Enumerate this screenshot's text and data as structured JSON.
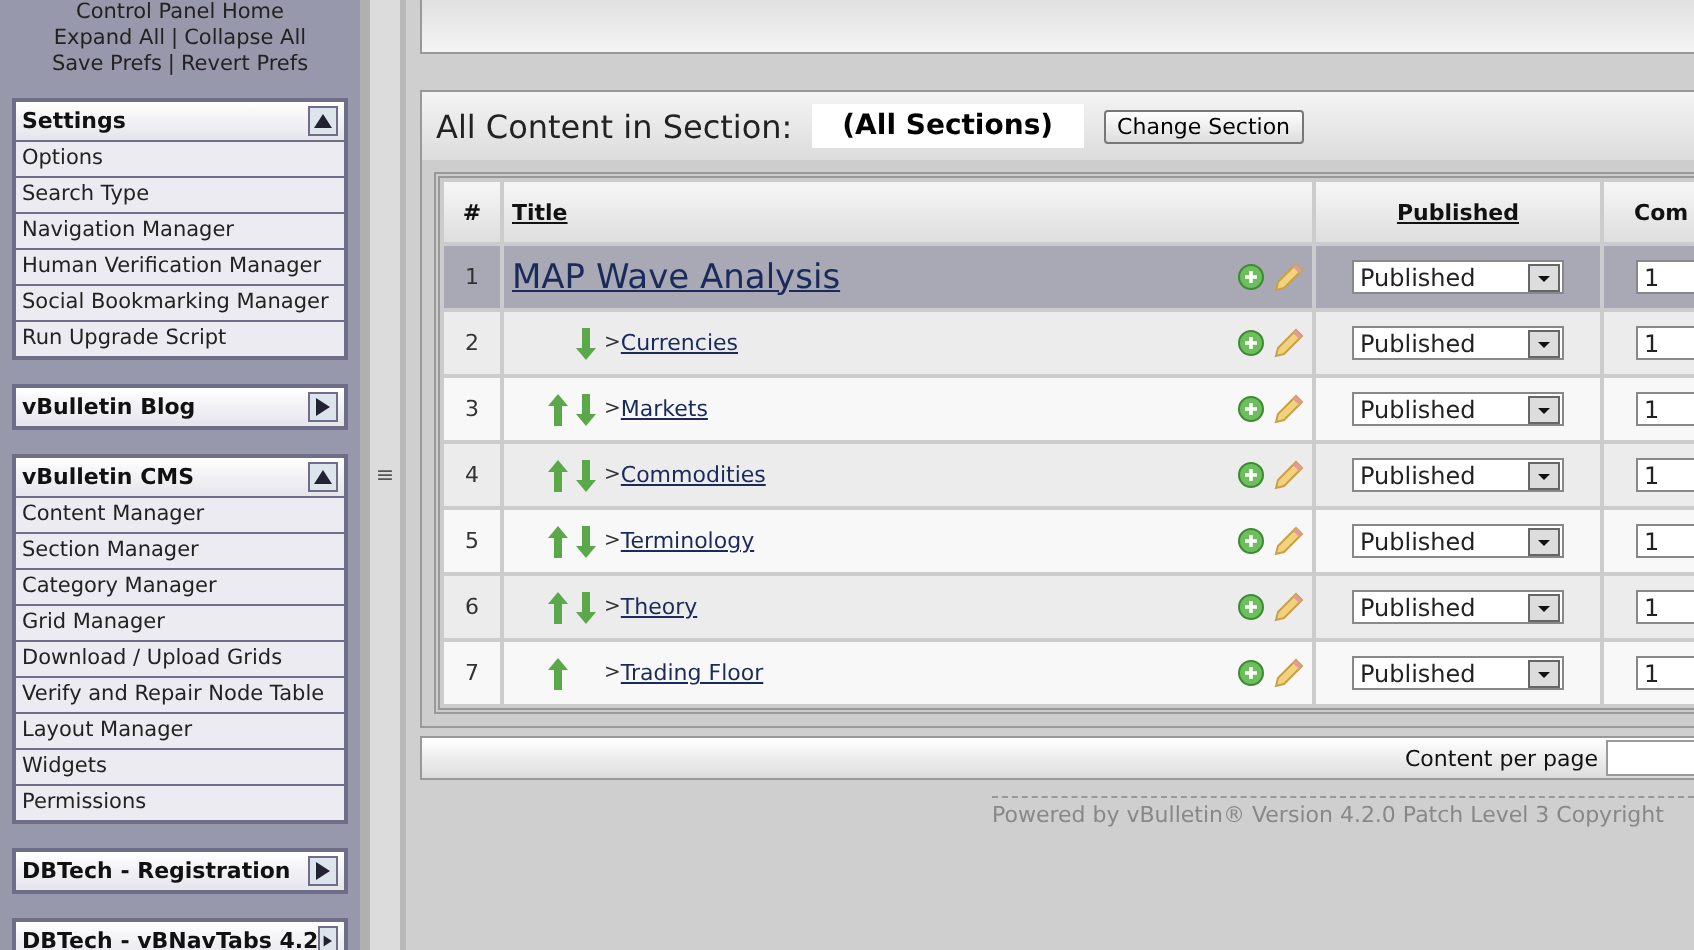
{
  "nav_links": {
    "home": "Control Panel Home",
    "expand_all": "Expand All",
    "collapse_all": "Collapse All",
    "separator": "|",
    "save_prefs": "Save Prefs",
    "revert_prefs": "Revert Prefs"
  },
  "sidebar_groups": [
    {
      "title": "Settings",
      "expanded": true,
      "items": [
        "Options",
        "Search Type",
        "Navigation Manager",
        "Human Verification Manager",
        "Social Bookmarking Manager",
        "Run Upgrade Script"
      ]
    },
    {
      "title": "vBulletin Blog",
      "expanded": false
    },
    {
      "title": "vBulletin CMS",
      "expanded": true,
      "items": [
        "Content Manager",
        "Section Manager",
        "Category Manager",
        "Grid Manager",
        "Download / Upload Grids",
        "Verify and Repair Node Table",
        "Layout Manager",
        "Widgets",
        "Permissions"
      ]
    },
    {
      "title": "DBTech - Registration",
      "expanded": false
    },
    {
      "title": "DBTech - vBNavTabs 4.2",
      "expanded": false
    }
  ],
  "splitter": {
    "grip": "≡"
  },
  "section_header": {
    "label": "All Content in Section:",
    "value": "(All Sections)",
    "button": "Change Section"
  },
  "table": {
    "columns": [
      "#",
      "Title",
      "Published",
      "Com"
    ],
    "rows": [
      {
        "number": "1",
        "kind": "section",
        "title": "MAP Wave Analysis",
        "published": "Published",
        "column_4": "1"
      },
      {
        "number": "2",
        "kind": "child",
        "move_up": false,
        "move_down": true,
        "prefix": ">",
        "title": "Currencies",
        "published": "Published",
        "column_4": "1"
      },
      {
        "number": "3",
        "kind": "child",
        "move_up": true,
        "move_down": true,
        "prefix": ">",
        "title": "Markets",
        "published": "Published",
        "column_4": "1"
      },
      {
        "number": "4",
        "kind": "child",
        "move_up": true,
        "move_down": true,
        "prefix": ">",
        "title": "Commodities",
        "published": "Published",
        "column_4": "1"
      },
      {
        "number": "5",
        "kind": "child",
        "move_up": true,
        "move_down": true,
        "prefix": ">",
        "title": "Terminology",
        "published": "Published",
        "column_4": "1"
      },
      {
        "number": "6",
        "kind": "child",
        "move_up": true,
        "move_down": true,
        "prefix": ">",
        "title": "Theory",
        "published": "Published",
        "column_4": "1"
      },
      {
        "number": "7",
        "kind": "child",
        "move_up": true,
        "move_down": false,
        "prefix": ">",
        "title": "Trading Floor",
        "published": "Published",
        "column_4": "1"
      }
    ]
  },
  "footer": {
    "per_page_label": "Content per page"
  },
  "copyright": "Powered by vBulletin® Version 4.2.0 Patch Level 3 Copyright"
}
